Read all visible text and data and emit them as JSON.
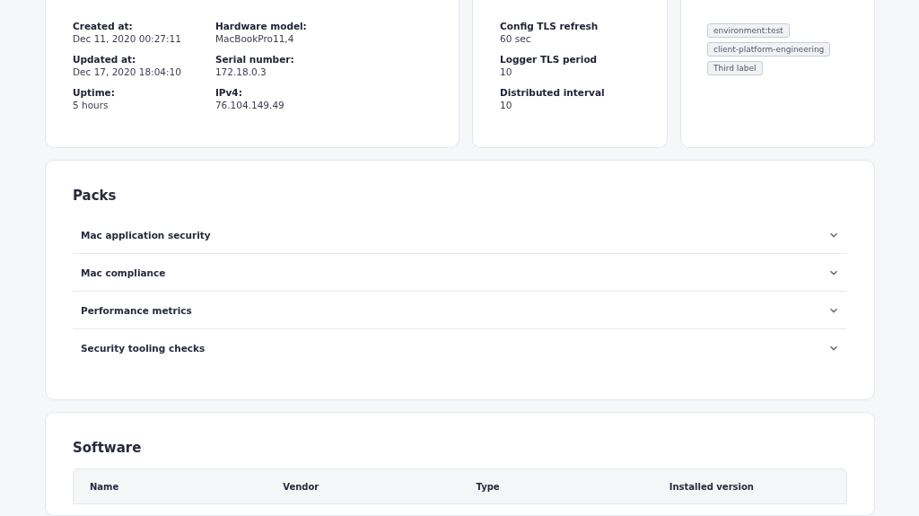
{
  "details": {
    "columns": [
      [
        {
          "label": "Created at:",
          "value": "Dec 11, 2020 00:27:11"
        },
        {
          "label": "Updated at:",
          "value": "Dec 17, 2020 18:04:10"
        },
        {
          "label": "Uptime:",
          "value": "5 hours"
        }
      ],
      [
        {
          "label": "Hardware model:",
          "value": "MacBookPro11,4"
        },
        {
          "label": "Serial number:",
          "value": "172.18.0.3"
        },
        {
          "label": "IPv4:",
          "value": "76.104.149.49"
        }
      ]
    ]
  },
  "config": {
    "items": [
      {
        "label": "Config TLS refresh",
        "value": "60 sec"
      },
      {
        "label": "Logger TLS period",
        "value": "10"
      },
      {
        "label": "Distributed interval",
        "value": "10"
      }
    ]
  },
  "labels": [
    "environment:test",
    "client-platform-engineering",
    "Third label"
  ],
  "packs": {
    "title": "Packs",
    "items": [
      {
        "name": "Mac application security",
        "expanded": false
      },
      {
        "name": "Mac compliance",
        "expanded": false
      },
      {
        "name": "Performance metrics",
        "expanded": false
      },
      {
        "name": "Security tooling checks",
        "expanded": false
      }
    ]
  },
  "software": {
    "title": "Software",
    "columns": [
      "Name",
      "Vendor",
      "Type",
      "Installed version"
    ]
  }
}
